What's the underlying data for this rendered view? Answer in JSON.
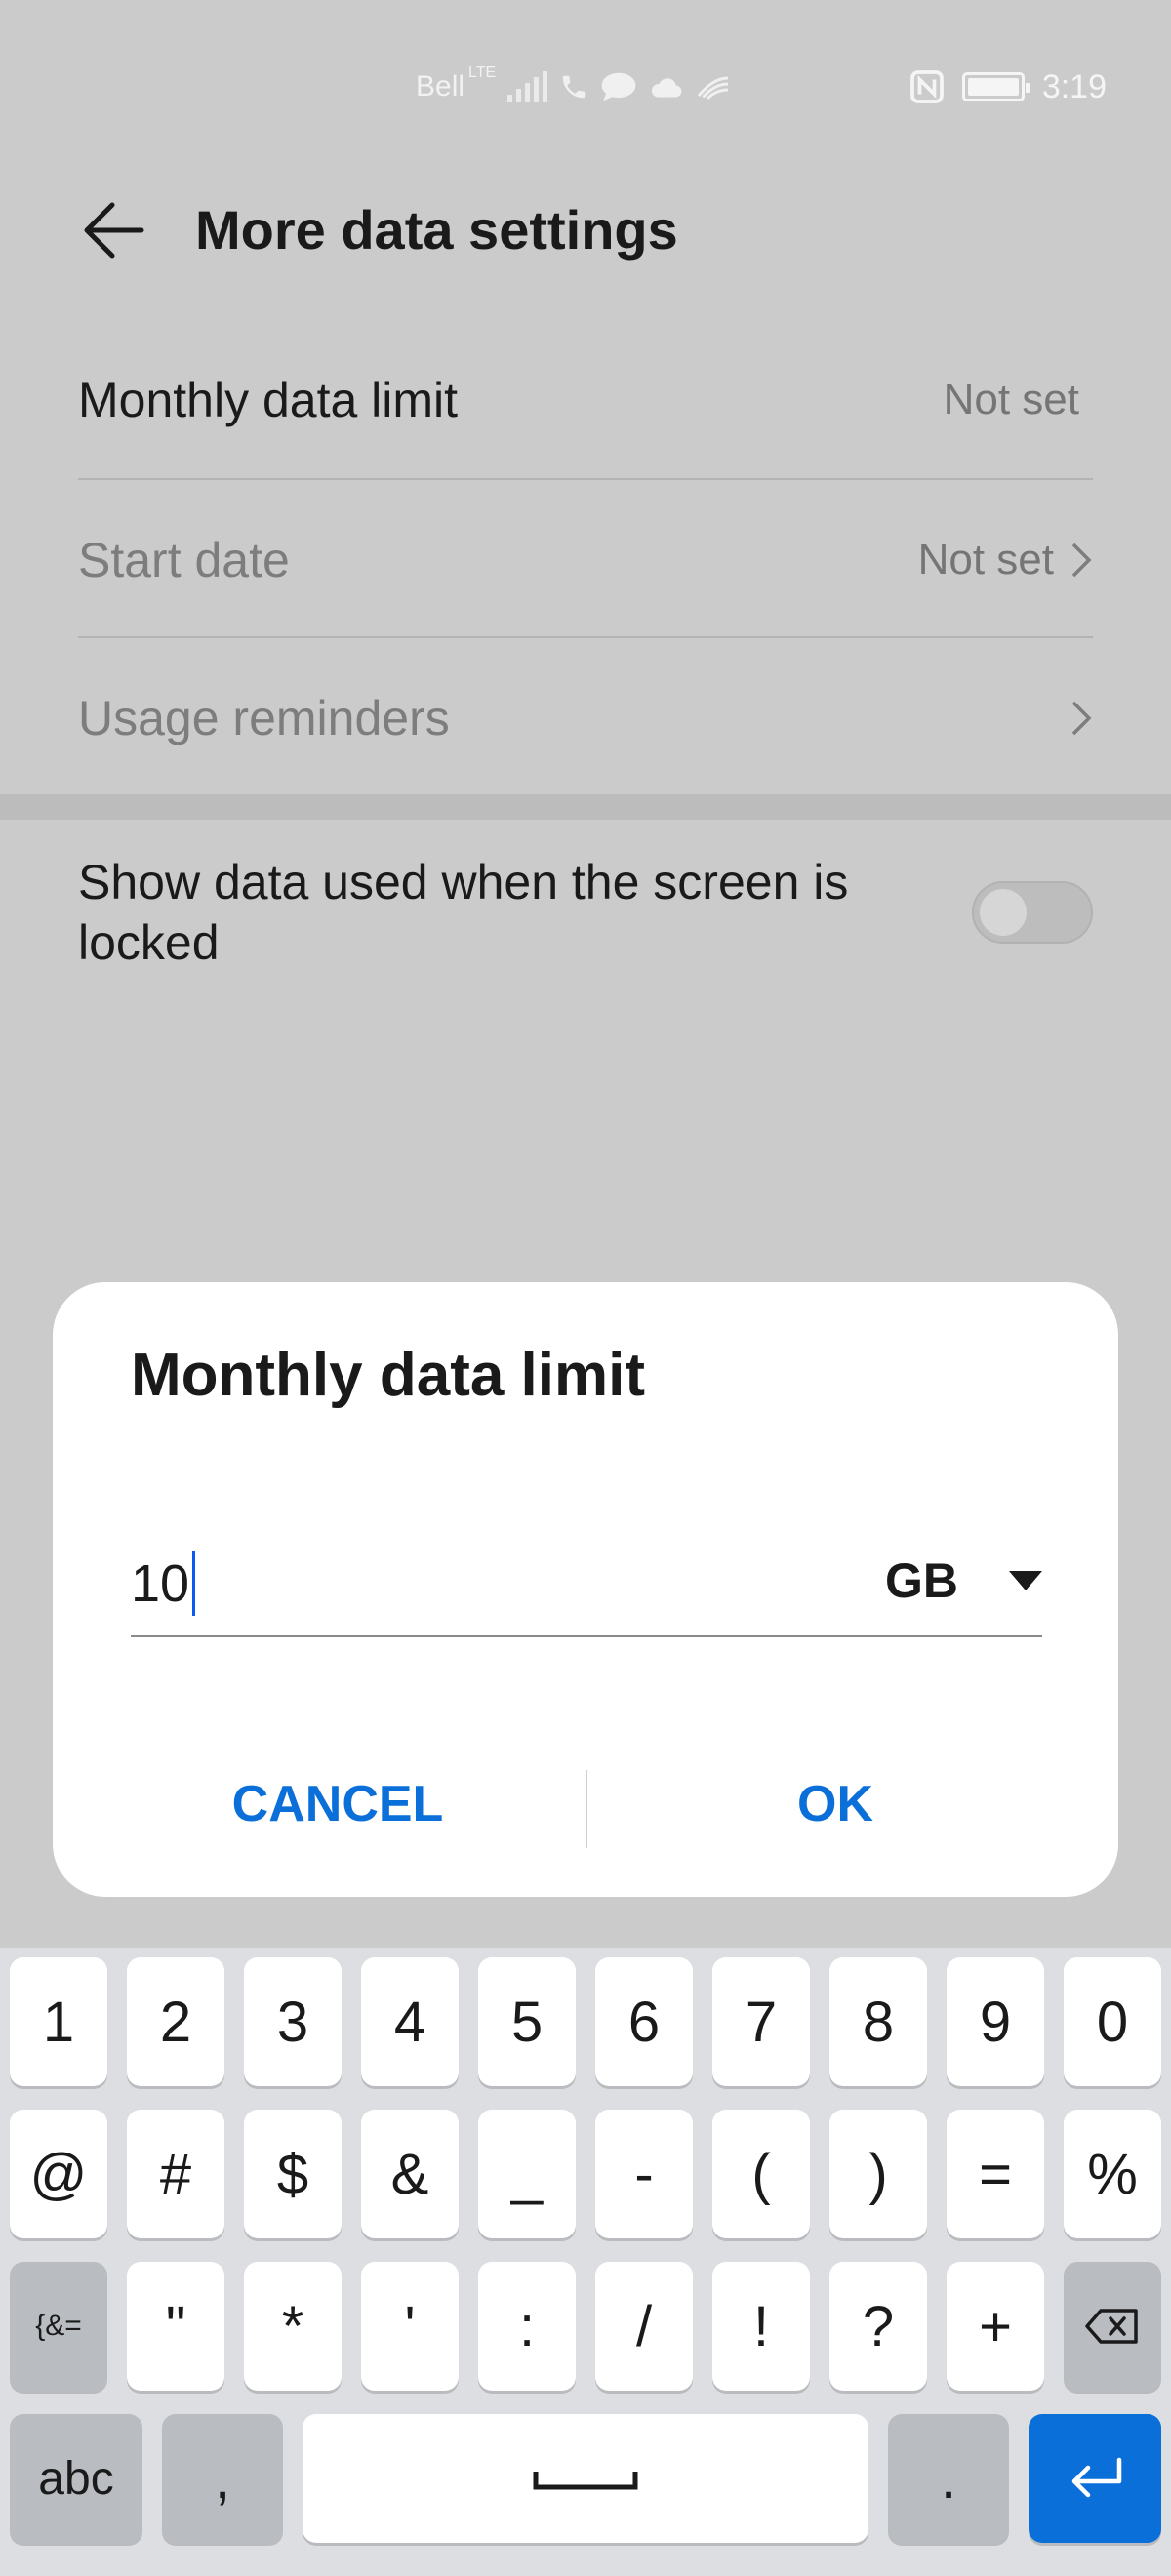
{
  "status_bar": {
    "carrier": "Bell",
    "network": "LTE",
    "time": "3:19",
    "icons": [
      "signal-icon",
      "wifi-calling-icon",
      "message-icon",
      "cloud-icon",
      "nfc-icon",
      "battery-icon"
    ]
  },
  "app_bar": {
    "title": "More data settings"
  },
  "settings": {
    "monthly_limit": {
      "label": "Monthly data limit",
      "value": "Not set"
    },
    "start_date": {
      "label": "Start date",
      "value": "Not set"
    },
    "usage_reminders": {
      "label": "Usage reminders"
    },
    "show_data_locked": {
      "label_line1": "Show data used when the screen is",
      "label_line2": "locked",
      "enabled": false
    }
  },
  "dialog": {
    "title": "Monthly data limit",
    "input_value": "10",
    "unit": "GB",
    "cancel_label": "CANCEL",
    "ok_label": "OK"
  },
  "keyboard": {
    "row1": [
      "1",
      "2",
      "3",
      "4",
      "5",
      "6",
      "7",
      "8",
      "9",
      "0"
    ],
    "row2": [
      "@",
      "#",
      "$",
      "&",
      "_",
      "-",
      "(",
      ")",
      "=",
      "%"
    ],
    "row3_toggle": "{&=",
    "row3": [
      "\"",
      "*",
      "'",
      ":",
      "/",
      "!",
      "?",
      "+"
    ],
    "abc_label": "abc",
    "comma": ",",
    "period": "."
  },
  "colors": {
    "accent": "#0a6fd8",
    "scrim_bg": "#cbcbcb",
    "dialog_bg": "#ffffff"
  }
}
